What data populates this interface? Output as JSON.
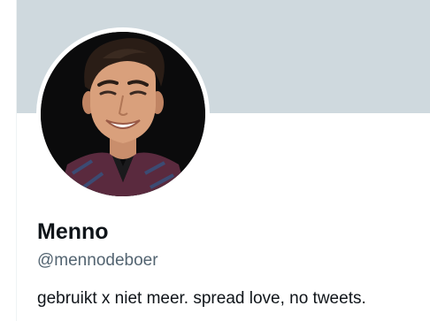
{
  "profile": {
    "display_name": "Menno",
    "handle": "@mennodeboer",
    "bio": "gebruikt x niet meer. spread love, no tweets."
  },
  "colors": {
    "banner": "#cfd9de",
    "name_text": "#0f1419",
    "handle_text": "#536471",
    "background": "#ffffff"
  },
  "icons": {
    "avatar": "profile-photo"
  }
}
